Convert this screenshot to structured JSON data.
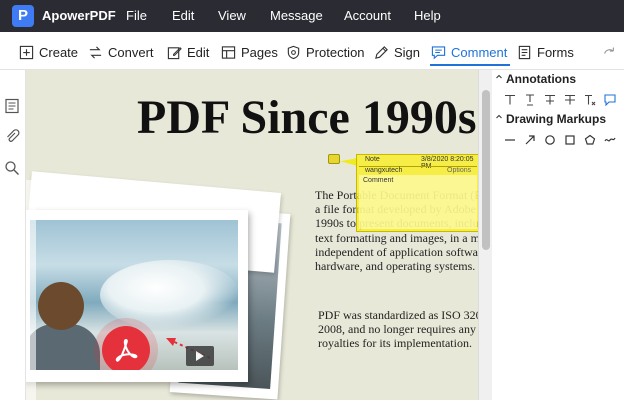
{
  "app": {
    "name": "ApowerPDF",
    "logo_letter": "P"
  },
  "menu": [
    "File",
    "Edit",
    "View",
    "Message",
    "Account",
    "Help"
  ],
  "toolbar": {
    "items": [
      {
        "label": "Create",
        "icon": "plus-box-icon"
      },
      {
        "label": "Convert",
        "icon": "convert-icon"
      },
      {
        "label": "Edit",
        "icon": "edit-icon"
      },
      {
        "label": "Pages",
        "icon": "pages-icon"
      },
      {
        "label": "Protection",
        "icon": "shield-icon"
      },
      {
        "label": "Sign",
        "icon": "pen-icon"
      },
      {
        "label": "Comment",
        "icon": "comment-icon",
        "active": true
      },
      {
        "label": "Forms",
        "icon": "forms-icon"
      }
    ],
    "accent": "#1f73d8"
  },
  "document": {
    "title": "PDF Since 1990s",
    "paragraph1": [
      "The Portable Document Format (P",
      "a file format developed by Adobe",
      "1990s to present documents, inclu",
      "text formatting and images, in a m",
      "independent of application softwa",
      "hardware, and operating systems."
    ],
    "paragraph2": [
      "PDF was standardized as ISO 320",
      "2008, and no longer requires any",
      "royalties for its implementation."
    ]
  },
  "note": {
    "type_label": "Note",
    "timestamp": "3/8/2020 8:20:05 PM",
    "author": "wangxutech",
    "options_label": "Options",
    "body": "Comment",
    "color": "#f5e82a"
  },
  "right_panel": {
    "annotations_heading": "Annotations",
    "drawing_heading": "Drawing Markups"
  }
}
